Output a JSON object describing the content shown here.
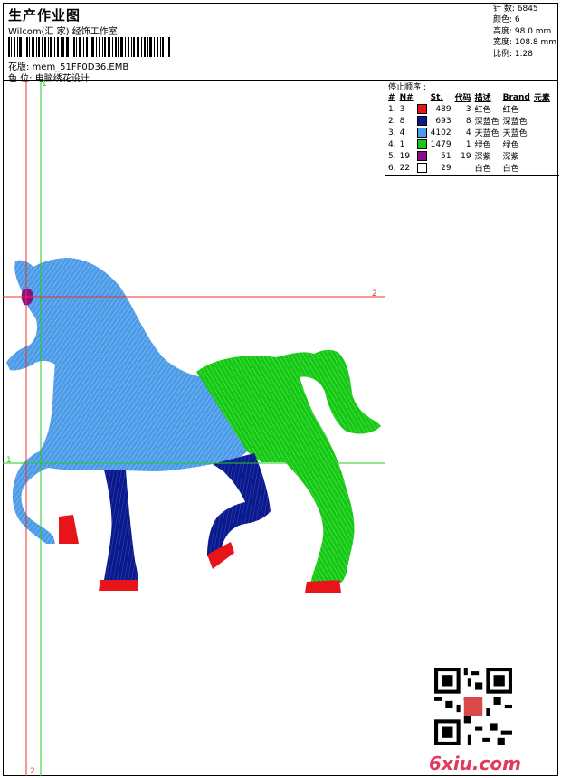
{
  "header": {
    "title": "生产作业图",
    "company": "Wilcom(汇 家) 经饰工作室",
    "pattern": "花版: mem_51FF0D36.EMB",
    "color_position": "色 位: 电脑绣花设计"
  },
  "stats": {
    "stitches": "针 数: 6845",
    "colors": "颜色: 6",
    "height": "高度: 98.0 mm",
    "width": "宽度: 108.8 mm",
    "scale": "比例: 1.28"
  },
  "sequence": {
    "title": "停止顺序 :",
    "headers": [
      "#",
      "N#",
      "St.",
      "代码",
      "描述",
      "Brand",
      "元素"
    ],
    "rows": [
      {
        "idx": "1.",
        "n": "3",
        "color": "#e8141a",
        "st": "489",
        "code": "3",
        "desc": "红色",
        "brand": "红色"
      },
      {
        "idx": "2.",
        "n": "8",
        "color": "#0a1a8c",
        "st": "693",
        "code": "8",
        "desc": "深蓝色",
        "brand": "深蓝色"
      },
      {
        "idx": "3.",
        "n": "4",
        "color": "#4c9be8",
        "st": "4102",
        "code": "4",
        "desc": "天蓝色",
        "brand": "天蓝色"
      },
      {
        "idx": "4.",
        "n": "1",
        "color": "#14c814",
        "st": "1479",
        "code": "1",
        "desc": "绿色",
        "brand": "绿色"
      },
      {
        "idx": "5.",
        "n": "19",
        "color": "#8a108a",
        "st": "51",
        "code": "19",
        "desc": "深紫",
        "brand": "深紫"
      },
      {
        "idx": "6.",
        "n": "22",
        "color": "#ffffff",
        "st": "29",
        "code": "",
        "desc": "白色",
        "brand": "白色"
      }
    ]
  },
  "guides": {
    "label_1": "1",
    "label_2": "2"
  },
  "watermark": {
    "site": "6xiu.com"
  },
  "colors": {
    "red": "#e8141a",
    "navy": "#0a1a8c",
    "sky": "#4c9be8",
    "green": "#14c814",
    "purple": "#8a108a",
    "guide_red": "#e83030",
    "guide_green": "#22cc22"
  }
}
